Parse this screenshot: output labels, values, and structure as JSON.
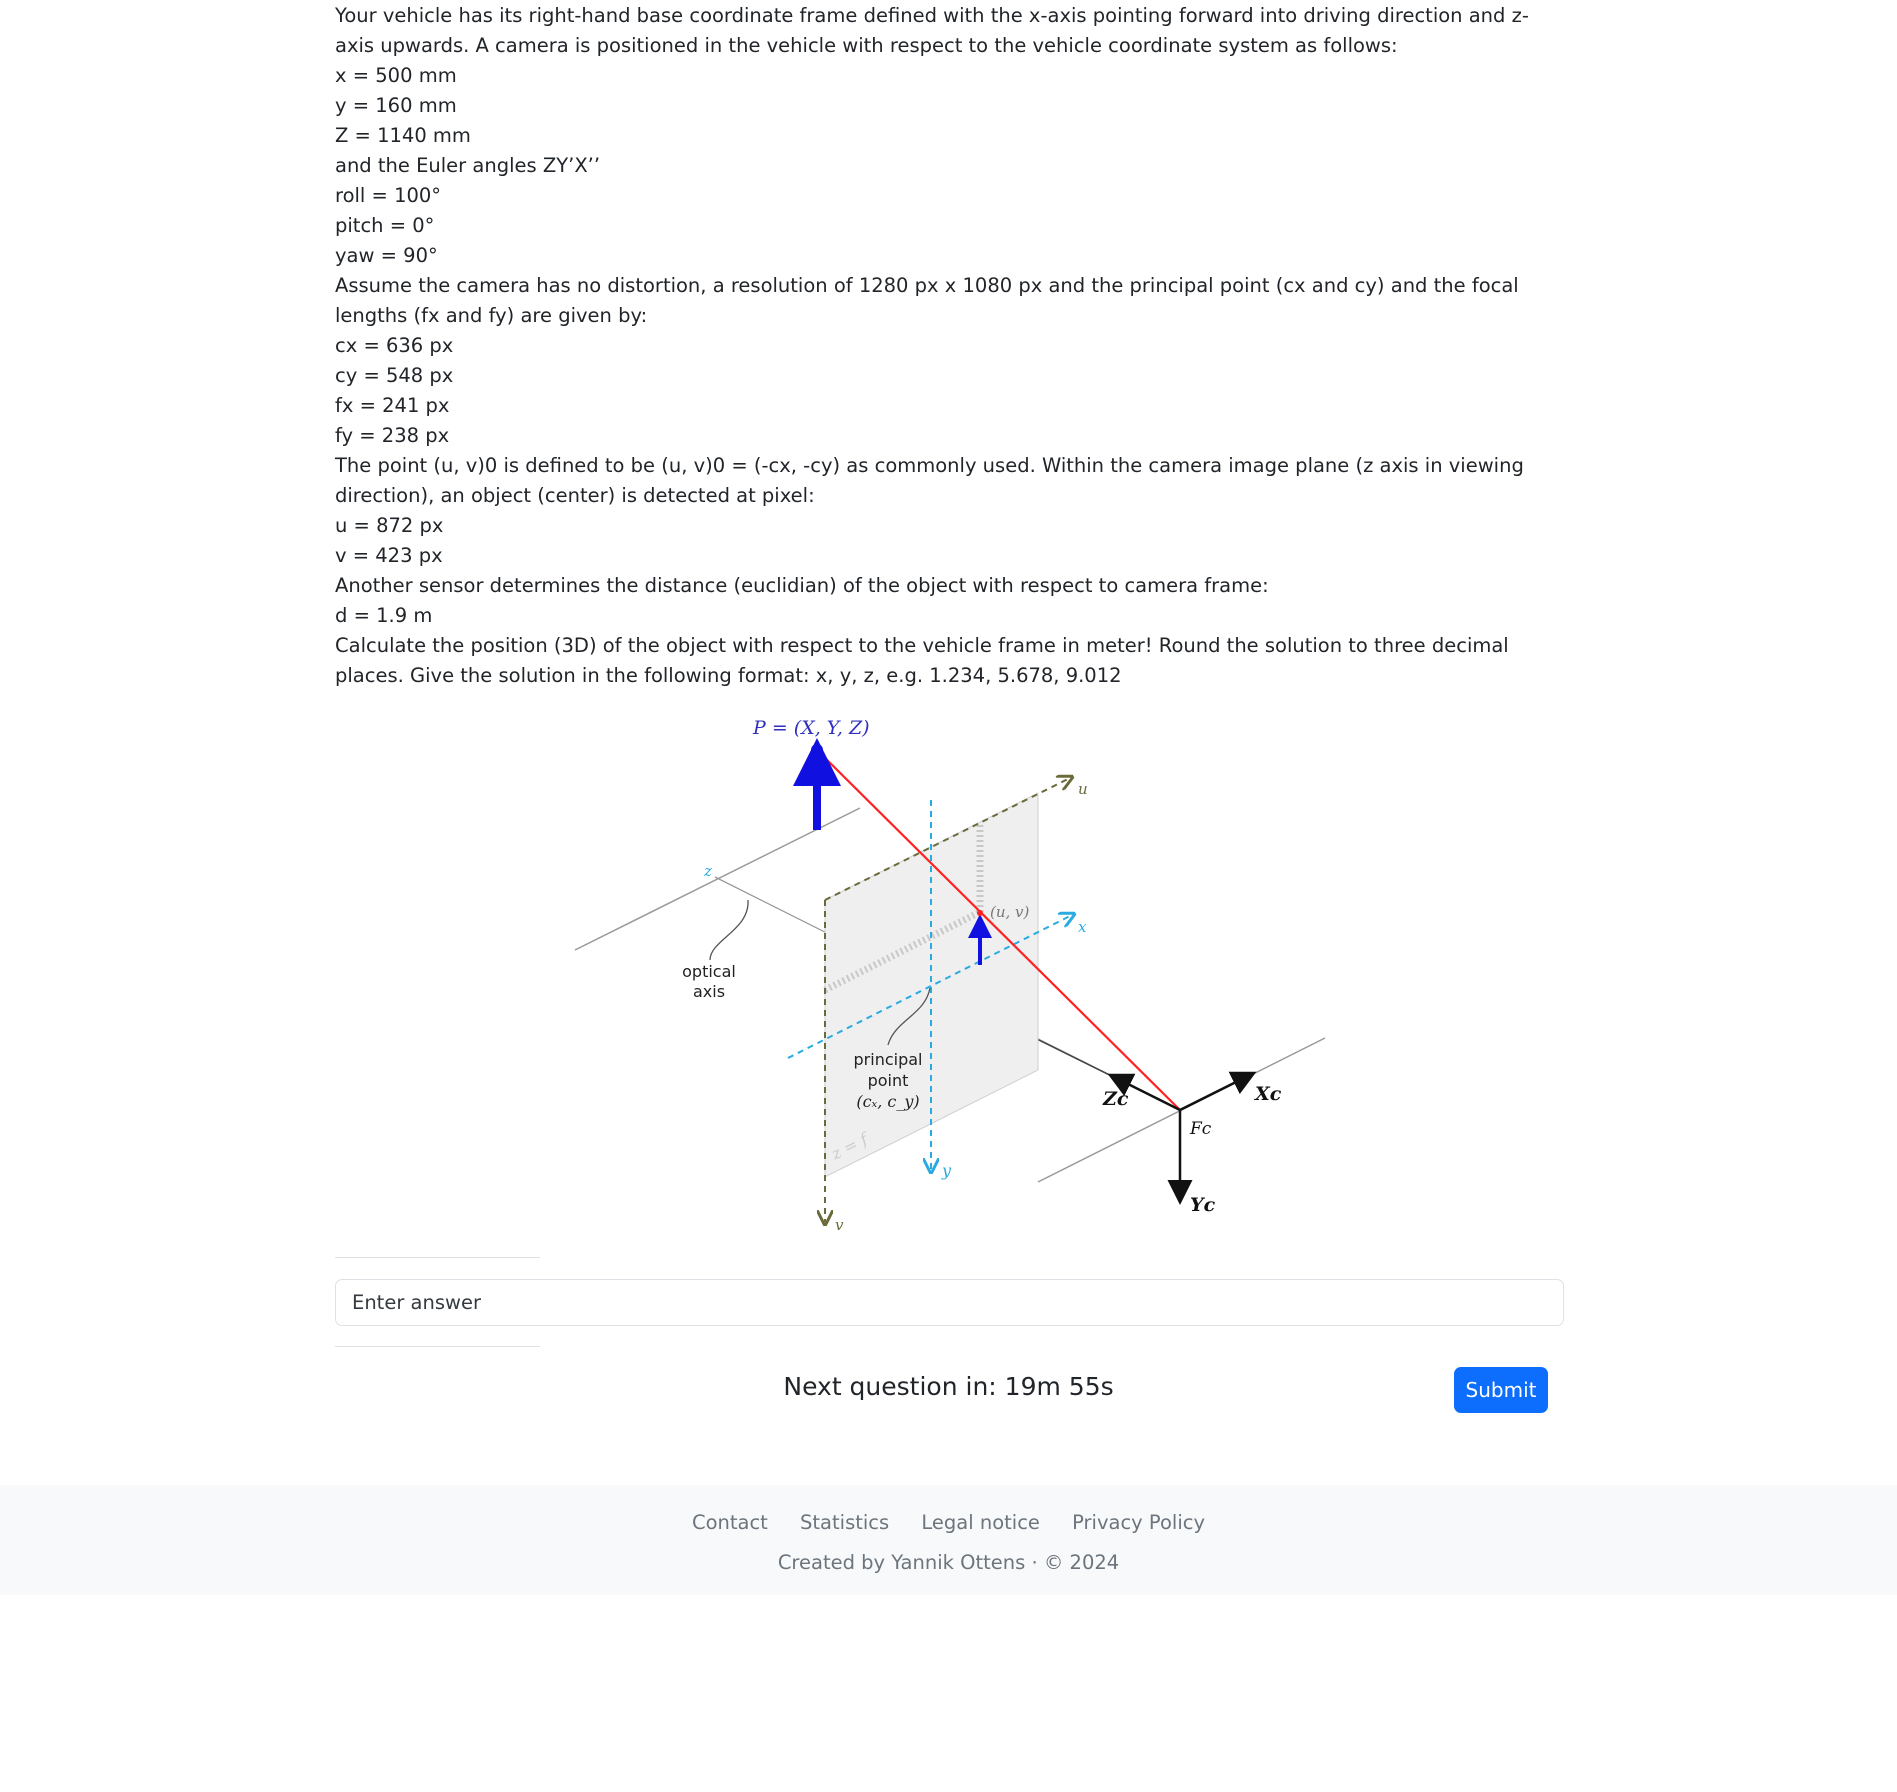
{
  "question": {
    "lines": [
      "Your vehicle has its right-hand base coordinate frame defined with the x-axis pointing forward into driving direction and z-axis upwards. A camera is positioned in the vehicle with respect to the vehicle coordinate system as follows:",
      "x = 500 mm",
      "y = 160 mm",
      "Z = 1140 mm",
      "and the Euler angles ZY’X’’",
      "roll = 100°",
      "pitch = 0°",
      "yaw = 90°",
      "Assume the camera has no distortion, a resolution of 1280 px x 1080 px and the principal point (cx and cy) and the focal lengths (fx and fy) are given by:",
      "cx = 636 px",
      "cy = 548 px",
      "fx = 241 px",
      "fy = 238 px",
      "The point (u, v)0 is defined to be (u, v)0 = (-cx, -cy) as commonly used. Within the camera image plane (z axis in viewing direction), an object (center) is detected at pixel:",
      "u = 872 px",
      "v = 423 px",
      "Another sensor determines the distance (euclidian) of the object with respect to camera frame:",
      "d = 1.9 m",
      "Calculate the position (3D) of the object with respect to the vehicle frame in meter! Round the solution to three decimal places. Give the solution in the following format: x, y, z, e.g. 1.234, 5.678, 9.012"
    ]
  },
  "figure": {
    "point_label": "P = (X, Y, Z)",
    "u_label": "u",
    "v_label": "v",
    "x_label": "x",
    "y_label": "y",
    "z_label": "z",
    "uv_label": "(u, v)",
    "optical_axis_1": "optical",
    "optical_axis_2": "axis",
    "principal_1": "principal",
    "principal_2": "point",
    "principal_3": "(cₓ, c_y)",
    "plane_label": "z = f",
    "zc_label": "Zc",
    "xc_label": "Xc",
    "yc_label": "Yc",
    "fc_label": "Fc",
    "colors": {
      "ray": "#ff2222",
      "point": "#1010e0",
      "cyan": "#29abe2",
      "olive": "#6b6b3a"
    }
  },
  "answer": {
    "placeholder": "Enter answer",
    "value": ""
  },
  "timer": {
    "text": "Next question in: 19m 55s"
  },
  "submit": {
    "label": "Submit"
  },
  "footer": {
    "links": [
      "Contact",
      "Statistics",
      "Legal notice",
      "Privacy Policy"
    ],
    "copyright": "Created by Yannik Ottens · © 2024"
  }
}
